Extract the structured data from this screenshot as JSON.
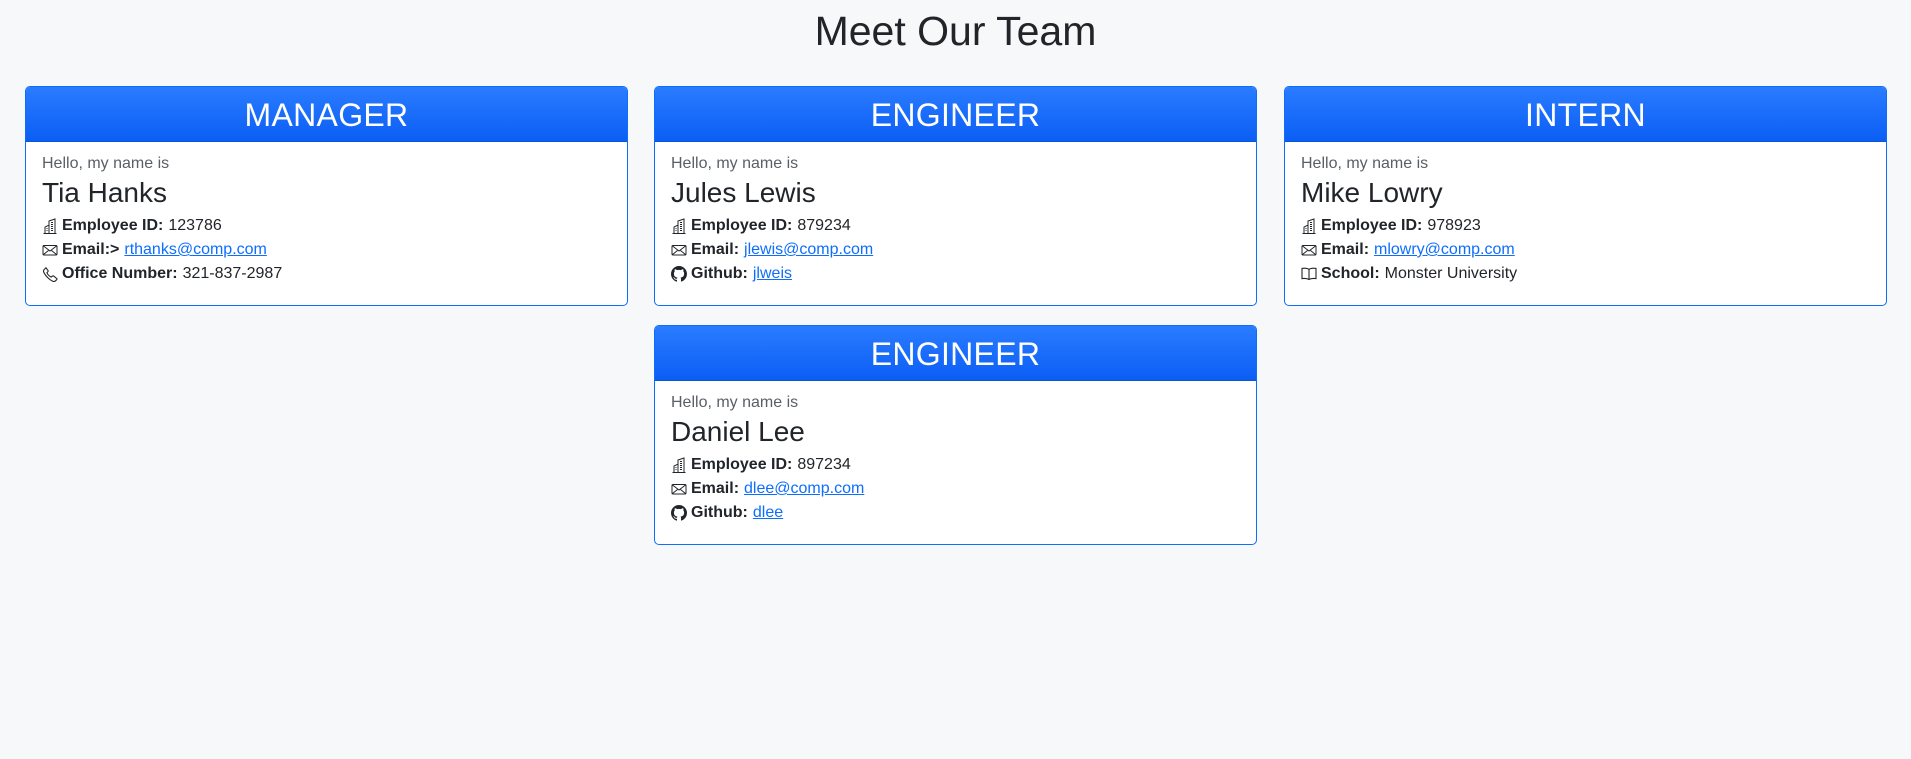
{
  "page": {
    "title": "Meet Our Team"
  },
  "greeting": "Hello, my name is",
  "cards": [
    {
      "role": "MANAGER",
      "name": "Tia Hanks",
      "rows": [
        {
          "icon": "building-icon",
          "label": "Employee ID:",
          "value": "123786"
        },
        {
          "icon": "envelope-icon",
          "label": "Email:>",
          "value": "rthanks@comp.com"
        },
        {
          "icon": "phone-icon",
          "label": "Office Number:",
          "value": "321-837-2987"
        }
      ]
    },
    {
      "role": "ENGINEER",
      "name": "Jules Lewis",
      "rows": [
        {
          "icon": "building-icon",
          "label": "Employee ID:",
          "value": "879234"
        },
        {
          "icon": "envelope-icon",
          "label": "Email:",
          "value": "jlewis@comp.com"
        },
        {
          "icon": "github-icon",
          "label": "Github:",
          "value": "jlweis"
        }
      ]
    },
    {
      "role": "INTERN",
      "name": "Mike Lowry",
      "rows": [
        {
          "icon": "building-icon",
          "label": "Employee ID:",
          "value": "978923"
        },
        {
          "icon": "envelope-icon",
          "label": "Email:",
          "value": "mlowry@comp.com"
        },
        {
          "icon": "book-icon",
          "label": "School:",
          "value": "Monster University"
        }
      ]
    },
    {
      "role": "ENGINEER",
      "name": "Daniel Lee",
      "rows": [
        {
          "icon": "building-icon",
          "label": "Employee ID:",
          "value": "897234"
        },
        {
          "icon": "envelope-icon",
          "label": "Email:",
          "value": "dlee@comp.com"
        },
        {
          "icon": "github-icon",
          "label": "Github:",
          "value": "dlee"
        }
      ]
    }
  ],
  "colors": {
    "accent": "#0d6efd",
    "background": "#f7f8fa"
  }
}
